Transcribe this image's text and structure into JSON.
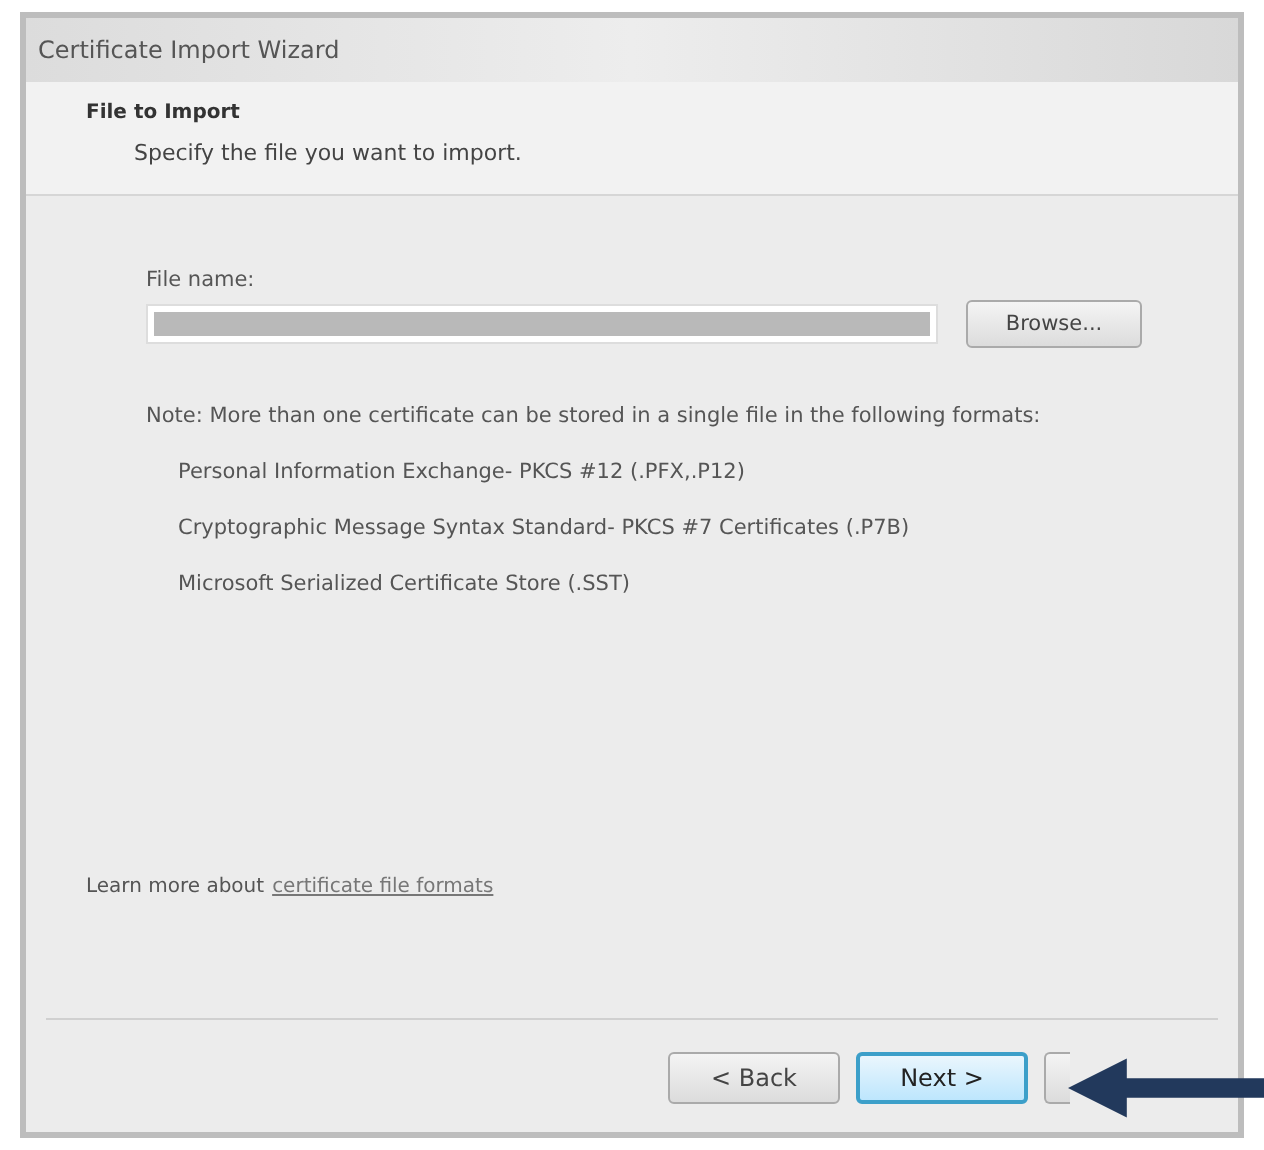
{
  "window": {
    "title": "Certificate Import Wizard"
  },
  "header": {
    "title": "File to Import",
    "subtitle": "Specify the file you want to import."
  },
  "file_name": {
    "label": "File name:"
  },
  "browse_button": "Browse...",
  "note": "Note:  More than one certificate can be stored in a single file in the following formats:",
  "formats": [
    "Personal Information Exchange- PKCS #12 (.PFX,.P12)",
    "Cryptographic Message Syntax Standard- PKCS #7 Certificates (.P7B)",
    "Microsoft Serialized Certificate Store (.SST)"
  ],
  "learn_more": {
    "text": "Learn more about",
    "link": "certificate file formats"
  },
  "buttons": [
    {
      "label": "< Back",
      "kind": "normal"
    },
    {
      "label": "Next >",
      "kind": "default"
    },
    {
      "kind": "covered"
    }
  ]
}
